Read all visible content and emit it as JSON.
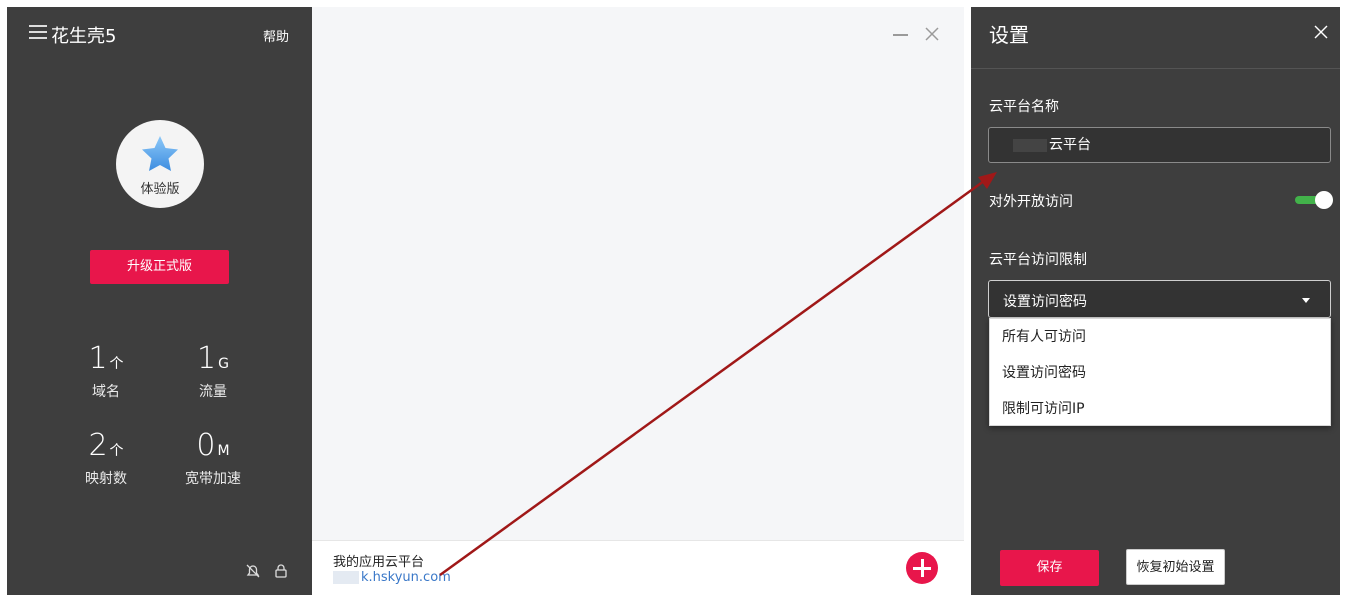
{
  "sidebar": {
    "title": "花生壳5",
    "help_label": "帮助",
    "avatar_label": "体验版",
    "upgrade_label": "升级正式版",
    "stats": [
      {
        "value": "1",
        "unit": "个",
        "label": "域名"
      },
      {
        "value": "1",
        "unit": "G",
        "label": "流量"
      },
      {
        "value": "2",
        "unit": "个",
        "label": "映射数"
      },
      {
        "value": "0",
        "unit": "M",
        "label": "宽带加速"
      }
    ],
    "icons": {
      "menu": "hamburger-menu-icon",
      "avatar": "star-icon",
      "notify": "bell-icon",
      "lock": "lock-icon"
    }
  },
  "middle": {
    "app_title": "我的应用云平台",
    "app_url": "k.hskyun.com",
    "icons": {
      "minimize": "minimize-icon",
      "close": "close-icon",
      "add": "plus-circle-icon"
    }
  },
  "settings": {
    "title": "设置",
    "name_label": "云平台名称",
    "name_value": "云平台",
    "public_access_label": "对外开放访问",
    "public_access_enabled": true,
    "restriction_label": "云平台访问限制",
    "restriction_selected": "设置访问密码",
    "restriction_options": [
      "所有人可访问",
      "设置访问密码",
      "限制可访问IP"
    ],
    "save_label": "保存",
    "reset_label": "恢复初始设置"
  },
  "colors": {
    "accent": "#e8164b",
    "panel_dark": "#3e3e3e",
    "toggle_on": "#42b24a",
    "link": "#3a78c8",
    "annotation_arrow": "#a01818"
  }
}
